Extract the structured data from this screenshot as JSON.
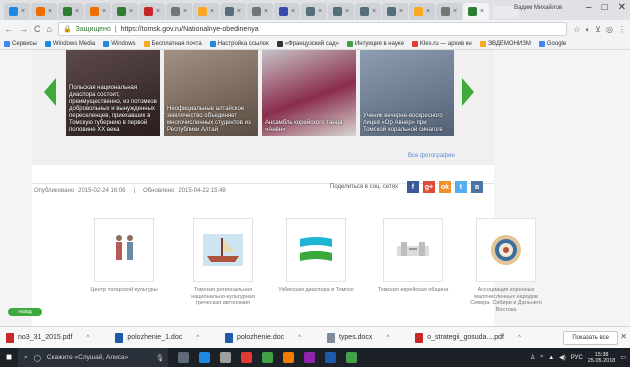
{
  "browser": {
    "tab_favicon_colors": [
      "#1e88e5",
      "#ef6c00",
      "#2e7d32",
      "#ef6c00",
      "#2e7d32",
      "#c62828",
      "#757575",
      "#f9a825",
      "#546e7a",
      "#757575",
      "#3949ab",
      "#546e7a",
      "#546e7a",
      "#546e7a",
      "#546e7a",
      "#f9a825",
      "#757575",
      "#2e7d32"
    ],
    "profile": "Вадим Михайлов",
    "address": {
      "secure_label": "Защищено",
      "url": "https://tomsk.gov.ru/Nationalnye-obedinenya"
    },
    "bookmarks": [
      {
        "label": "Сервисы",
        "color": "#4285f4"
      },
      {
        "label": "Windows Media",
        "color": "#1e88e5"
      },
      {
        "label": "Windows",
        "color": "#1e88e5"
      },
      {
        "label": "Бесплатная почта",
        "color": "#f9a825"
      },
      {
        "label": "Настройка ссылок",
        "color": "#1e88e5"
      },
      {
        "label": "«Французский сад»",
        "color": "#333333"
      },
      {
        "label": "Интуиция в науке",
        "color": "#43a047"
      },
      {
        "label": "Kles.ru — архив кн",
        "color": "#e53935"
      },
      {
        "label": "ЭВДЕМОНИЗМ",
        "color": "#f9a825"
      },
      {
        "label": "Google",
        "color": "#4285f4"
      }
    ]
  },
  "gallery": {
    "items": [
      {
        "caption": "Польская национальная диаспора состоит, преимущественно, из потомков добровольных и вынужденных переселенцев, приехавших в Томскую губернию в первой половине XX века"
      },
      {
        "caption": "Неофициальные алтайское землячество объединяет многочисленных студентов из Республики Алтай"
      },
      {
        "caption": "Ансамбль корейского танца «Анён»"
      },
      {
        "caption": "Ученик вечерне-воскресного лицея «Ор Авнер» при Томской хоральной синагоге"
      }
    ],
    "all_photos": "Все фотографии"
  },
  "meta": {
    "published_label": "Опубликовано",
    "published_date": "2015-02-24 16:06",
    "separator": "|",
    "updated_label": "Обновлено",
    "updated_date": "2015-04-22 15:48",
    "share_label": "Поделиться в соц. сетях",
    "share_buttons": [
      {
        "glyph": "f",
        "color": "#3b5998"
      },
      {
        "glyph": "g+",
        "color": "#dd4b39"
      },
      {
        "glyph": "ok",
        "color": "#f2912b"
      },
      {
        "glyph": "t",
        "color": "#55acee"
      },
      {
        "glyph": "в",
        "color": "#4c75a3"
      }
    ]
  },
  "documents": [
    {
      "label": "Центр татарской культуры"
    },
    {
      "label": "Томская региональная национально-культурная греческая автономия"
    },
    {
      "label": "Узбекская диаспора в Томске"
    },
    {
      "label": "Томская еврейская община"
    },
    {
      "label": "Ассоциация коренных малочисленных народов Севера, Сибири и Дальнего Востока"
    }
  ],
  "badge": "назад",
  "downloads": {
    "items": [
      {
        "name": "no3_31_2015.pdf",
        "color": "#c62828"
      },
      {
        "name": "polozhenie_1.doc",
        "color": "#1e5aa8"
      },
      {
        "name": "polozhenie.doc",
        "color": "#1e5aa8"
      },
      {
        "name": "types.docx",
        "color": "#7f8c99"
      },
      {
        "name": "o_strategii_gosuda....pdf",
        "color": "#c62828"
      }
    ],
    "show_all": "Показать все"
  },
  "taskbar": {
    "search_text": "Скажите «Слушай, Алиса»",
    "lang": "РУС",
    "time": "15:38",
    "date": "25.05.2018"
  }
}
